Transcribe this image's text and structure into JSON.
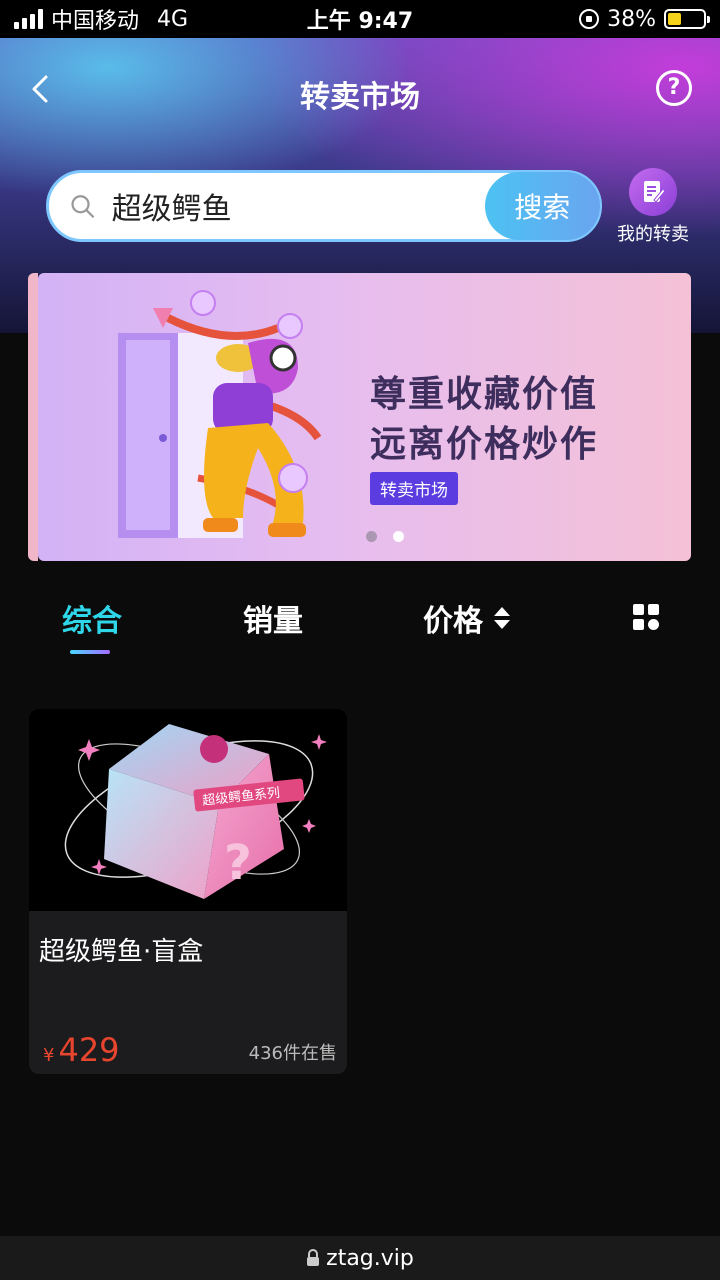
{
  "status_bar": {
    "carrier": "中国移动",
    "network": "4G",
    "time": "上午 9:47",
    "battery": "38%",
    "battery_level": 0.38
  },
  "header": {
    "title": "转卖市场"
  },
  "search": {
    "value": "超级鳄鱼",
    "button_label": "搜索"
  },
  "my_resale": {
    "label": "我的转卖"
  },
  "banner": {
    "line1": "尊重收藏价值",
    "line2": "远离价格炒作",
    "tag": "转卖市场",
    "page_count": 2,
    "active_page": 2
  },
  "tabs": {
    "comprehensive": "综合",
    "sales": "销量",
    "price": "价格"
  },
  "products": [
    {
      "title": "超级鳄鱼·盲盒",
      "currency": "¥",
      "price": "429",
      "stock": "436件在售",
      "box_label": "超级鳄鱼系列"
    }
  ],
  "url_bar": {
    "url": "ztag.vip"
  },
  "colors": {
    "accent_cyan": "#2fd6e8",
    "price_red": "#e8452e",
    "banner_tag": "#5a3ce0",
    "battery_yellow": "#f5d31a"
  }
}
